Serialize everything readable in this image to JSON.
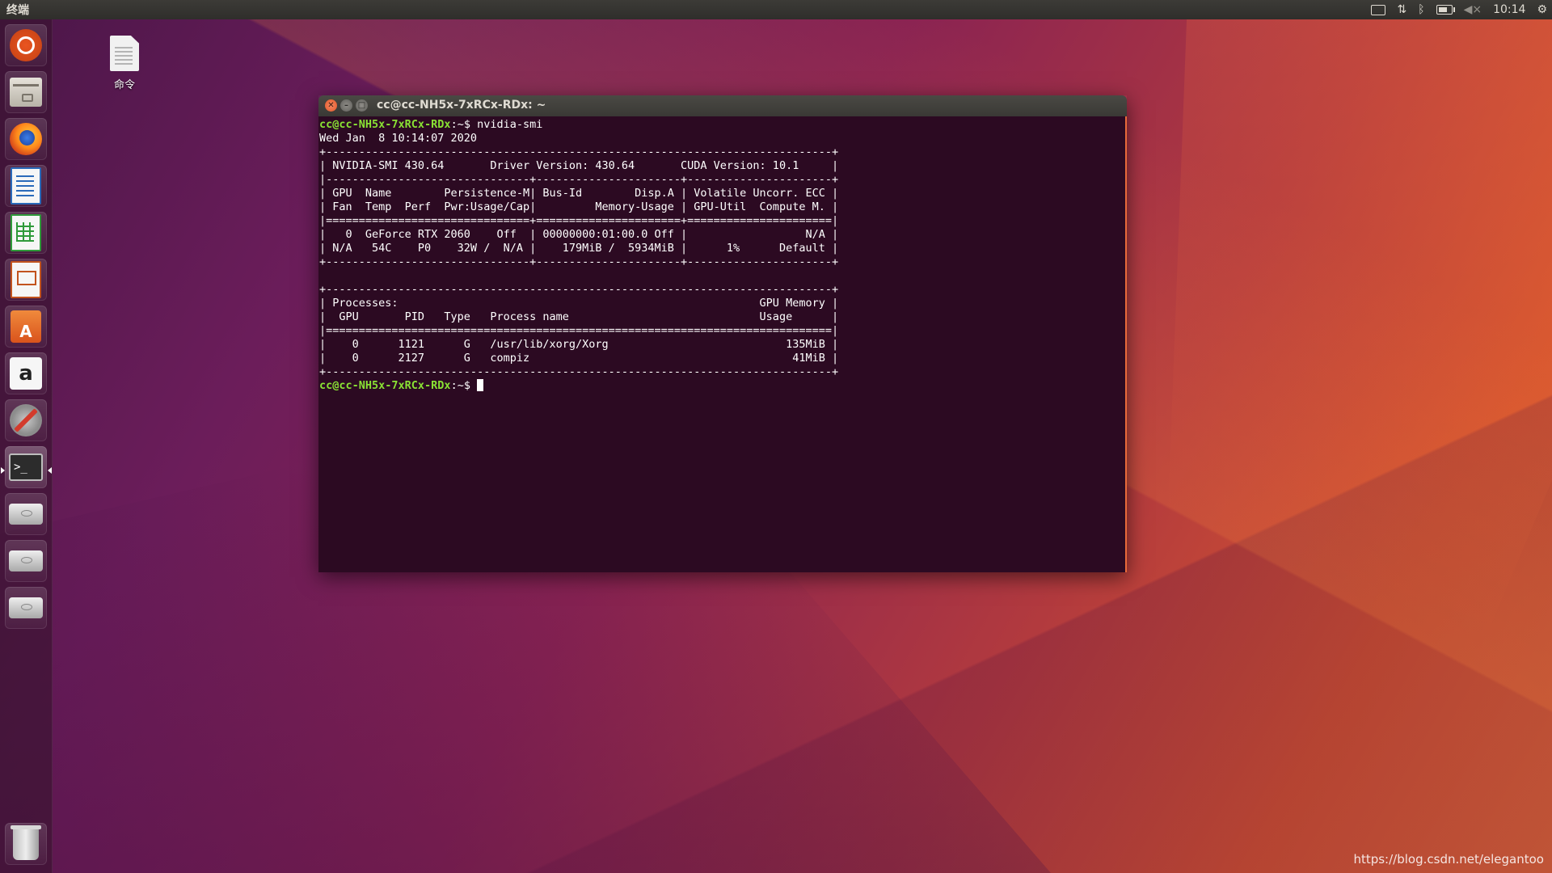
{
  "top_panel": {
    "app_title": "终端",
    "clock": "10:14",
    "indicators": [
      "keyboard-icon",
      "network-icon",
      "bluetooth-icon",
      "battery-icon",
      "volume-muted-icon",
      "gear-icon"
    ]
  },
  "launcher": {
    "items": [
      "ubuntu-dash",
      "files",
      "firefox",
      "libreoffice-writer",
      "libreoffice-calc",
      "libreoffice-impress",
      "ubuntu-software",
      "amazon",
      "system-settings",
      "terminal",
      "drive",
      "drive",
      "drive",
      "trash"
    ],
    "active_item": "terminal"
  },
  "desktop": {
    "icons": [
      {
        "label": "命令",
        "icon": "text-file-icon"
      }
    ]
  },
  "window": {
    "title": "cc@cc-NH5x-7xRCx-RDx: ~",
    "prompt_user": "cc@cc-NH5x-7xRCx-RDx",
    "prompt_path": ":~$",
    "command": " nvidia-smi",
    "output": [
      "Wed Jan  8 10:14:07 2020",
      "+-----------------------------------------------------------------------------+",
      "| NVIDIA-SMI 430.64       Driver Version: 430.64       CUDA Version: 10.1     |",
      "|-------------------------------+----------------------+----------------------+",
      "| GPU  Name        Persistence-M| Bus-Id        Disp.A | Volatile Uncorr. ECC |",
      "| Fan  Temp  Perf  Pwr:Usage/Cap|         Memory-Usage | GPU-Util  Compute M. |",
      "|===============================+======================+======================|",
      "|   0  GeForce RTX 2060    Off  | 00000000:01:00.0 Off |                  N/A |",
      "| N/A   54C    P0    32W /  N/A |    179MiB /  5934MiB |      1%      Default |",
      "+-------------------------------+----------------------+----------------------+",
      "",
      "+-----------------------------------------------------------------------------+",
      "| Processes:                                                       GPU Memory |",
      "|  GPU       PID   Type   Process name                             Usage      |",
      "|=============================================================================|",
      "|    0      1121      G   /usr/lib/xorg/Xorg                           135MiB |",
      "|    0      2127      G   compiz                                        41MiB |",
      "+-----------------------------------------------------------------------------+"
    ]
  },
  "watermark": "https://blog.csdn.net/elegantoo"
}
